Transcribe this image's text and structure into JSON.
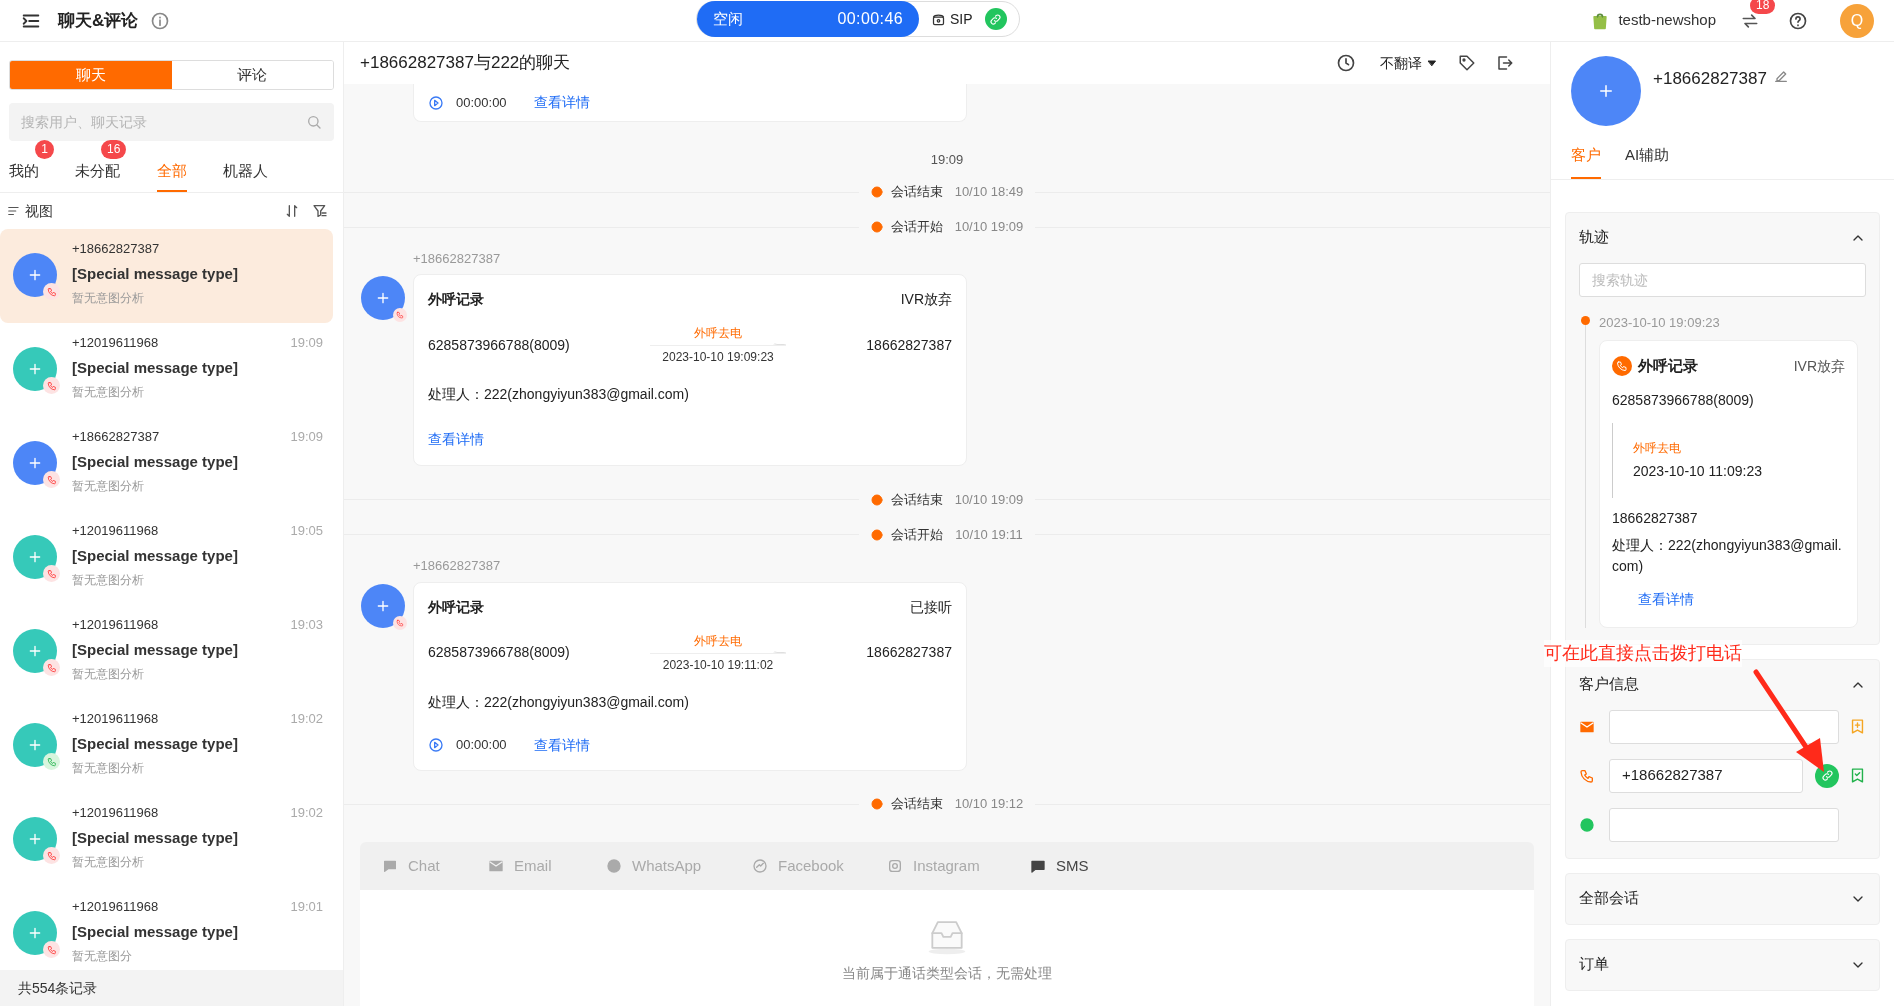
{
  "top_bar": {
    "title": "聊天&评论",
    "status": "空闲",
    "timer": "00:00:46",
    "sip": "SIP",
    "shop": "testb-newshop",
    "notification_badge": "18",
    "avatar": "Q"
  },
  "sidebar": {
    "tabs": [
      {
        "label": "聊天",
        "selected": true
      },
      {
        "label": "评论",
        "selected": false
      }
    ],
    "search": {
      "placeholder": "搜索用户、聊天记录"
    },
    "filters": [
      {
        "label": "我的",
        "badge": "1",
        "selected": false
      },
      {
        "label": "未分配",
        "badge": "16",
        "selected": false
      },
      {
        "label": "全部",
        "selected": true
      },
      {
        "label": "机器人",
        "selected": false
      }
    ],
    "view": "视图",
    "conversations": [
      {
        "phone": "+18662827387",
        "message": "[Special message type]",
        "intent": "暂无意图分析",
        "selected": true,
        "color": "#4d86f7",
        "kind": "missed"
      },
      {
        "phone": "+12019611968",
        "time": "19:09",
        "message": "[Special message type]",
        "intent": "暂无意图分析",
        "selected": false,
        "color": "#36c9b9",
        "kind": "missed"
      },
      {
        "phone": "+18662827387",
        "time": "19:09",
        "message": "[Special message type]",
        "intent": "暂无意图分析",
        "selected": false,
        "color": "#4d86f7",
        "kind": "missed"
      },
      {
        "phone": "+12019611968",
        "time": "19:05",
        "message": "[Special message type]",
        "intent": "暂无意图分析",
        "selected": false,
        "color": "#36c9b9",
        "kind": "missed"
      },
      {
        "phone": "+12019611968",
        "time": "19:03",
        "message": "[Special message type]",
        "intent": "暂无意图分析",
        "selected": false,
        "color": "#36c9b9",
        "kind": "missed"
      },
      {
        "phone": "+12019611968",
        "time": "19:02",
        "message": "[Special message type]",
        "intent": "暂无意图分析",
        "selected": false,
        "color": "#36c9b9",
        "kind": "answered"
      },
      {
        "phone": "+12019611968",
        "time": "19:02",
        "message": "[Special message type]",
        "intent": "暂无意图分析",
        "selected": false,
        "color": "#36c9b9",
        "kind": "missed"
      },
      {
        "phone": "+12019611968",
        "time": "19:01",
        "message": "[Special message type]",
        "intent": "暂无意图分",
        "selected": false,
        "color": "#36c9b9",
        "kind": "missed"
      }
    ],
    "footer": "共554条记录"
  },
  "chat": {
    "title": "+18662827387与222的聊天",
    "translate": "不翻译",
    "messages": [
      {
        "kind": "card_tail",
        "duration": "00:00:00",
        "link": "查看详情"
      },
      {
        "kind": "time",
        "text": "19:09"
      },
      {
        "kind": "event",
        "label": "会话结束",
        "time": "10/10 18:49"
      },
      {
        "kind": "event",
        "label": "会话开始",
        "time": "10/10 19:09"
      },
      {
        "kind": "call_card",
        "sender": "+18662827387",
        "title": "外呼记录",
        "status": "IVR放弃",
        "from": "6285873966788(8009)",
        "direction": "外呼去电",
        "time": "2023-10-10 19:09:23",
        "to": "18662827387",
        "handler": "处理人：222(zhongyiyun383@gmail.com)",
        "link": "查看详情"
      },
      {
        "kind": "event",
        "label": "会话结束",
        "time": "10/10 19:09"
      },
      {
        "kind": "event",
        "label": "会话开始",
        "time": "10/10 19:11"
      },
      {
        "kind": "call_card",
        "sender": "+18662827387",
        "title": "外呼记录",
        "status": "已接听",
        "from": "6285873966788(8009)",
        "direction": "外呼去电",
        "time": "2023-10-10 19:11:02",
        "to": "18662827387",
        "handler": "处理人：222(zhongyiyun383@gmail.com)",
        "duration": "00:00:00",
        "link": "查看详情"
      },
      {
        "kind": "event",
        "label": "会话结束",
        "time": "10/10 19:12"
      }
    ],
    "composer": {
      "channels": [
        {
          "kind": "chat",
          "label": "Chat"
        },
        {
          "kind": "email",
          "label": "Email"
        },
        {
          "kind": "whatsapp",
          "label": "WhatsApp"
        },
        {
          "kind": "facebook",
          "label": "Facebook"
        },
        {
          "kind": "instagram",
          "label": "Instagram"
        },
        {
          "kind": "sms",
          "label": "SMS"
        }
      ],
      "empty_text": "当前属于通话类型会话，无需处理"
    }
  },
  "customer": {
    "phone": "+18662827387",
    "tabs": [
      {
        "label": "客户",
        "selected": true
      },
      {
        "label": "AI辅助",
        "selected": false
      }
    ],
    "sections": [
      {
        "kind": "track",
        "title": "轨迹",
        "expanded": true,
        "search_placeholder": "搜索轨迹",
        "entry": {
          "date": "2023-10-10 19:09:23",
          "title": "外呼记录",
          "status": "IVR放弃",
          "from": "6285873966788(8009)",
          "direction": "外呼去电",
          "time": "2023-10-10 11:09:23",
          "to": "18662827387",
          "handler": "处理人：222(zhongyiyun383@gmail.com)",
          "link": "查看详情"
        }
      },
      {
        "kind": "info",
        "title": "客户信息",
        "expanded": true,
        "fields": [
          {
            "kind": "email"
          },
          {
            "kind": "phone",
            "value": "+18662827387"
          },
          {
            "kind": "whatsapp"
          }
        ]
      },
      {
        "title": "全部会话",
        "expanded": false
      },
      {
        "title": "订单",
        "expanded": false
      }
    ]
  },
  "annotation": "可在此直接点击拨打电话"
}
